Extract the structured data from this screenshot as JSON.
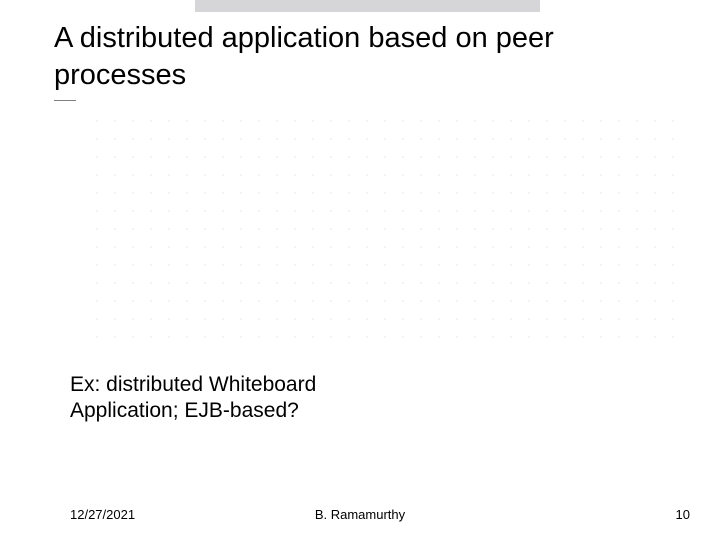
{
  "slide": {
    "title": "A distributed application based on peer processes",
    "body": "Ex: distributed Whiteboard Application; EJB-based?"
  },
  "footer": {
    "date": "12/27/2021",
    "author": "B. Ramamurthy",
    "page": "10"
  }
}
